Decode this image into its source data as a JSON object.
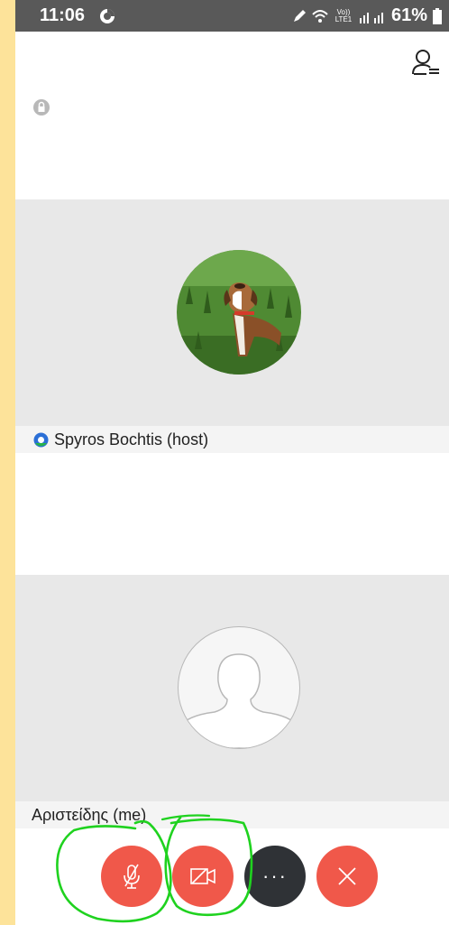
{
  "status_bar": {
    "time": "11:06",
    "battery": "61%",
    "network_label": "Vo)) LTE1"
  },
  "icons": {
    "sync": "sync-icon",
    "participants": "participants-list-icon",
    "lock": "lock-icon",
    "mic_off": "mic-off-icon",
    "video_off": "video-off-icon",
    "more": "more-dots-icon",
    "leave": "close-icon"
  },
  "participants": [
    {
      "name": "Spyros Bochtis (host)",
      "avatar": "dog-photo"
    },
    {
      "name": "Αριστείδης (me)",
      "avatar": "default-person"
    }
  ],
  "controls": {
    "more_label": "···"
  },
  "colors": {
    "status_bar": "#595959",
    "tile_bg": "#e8e8e8",
    "accent_red": "#f0584a",
    "dark_button": "#2f3236",
    "annotation_green": "#1fd21f",
    "frame_yellow": "#fde39a"
  }
}
